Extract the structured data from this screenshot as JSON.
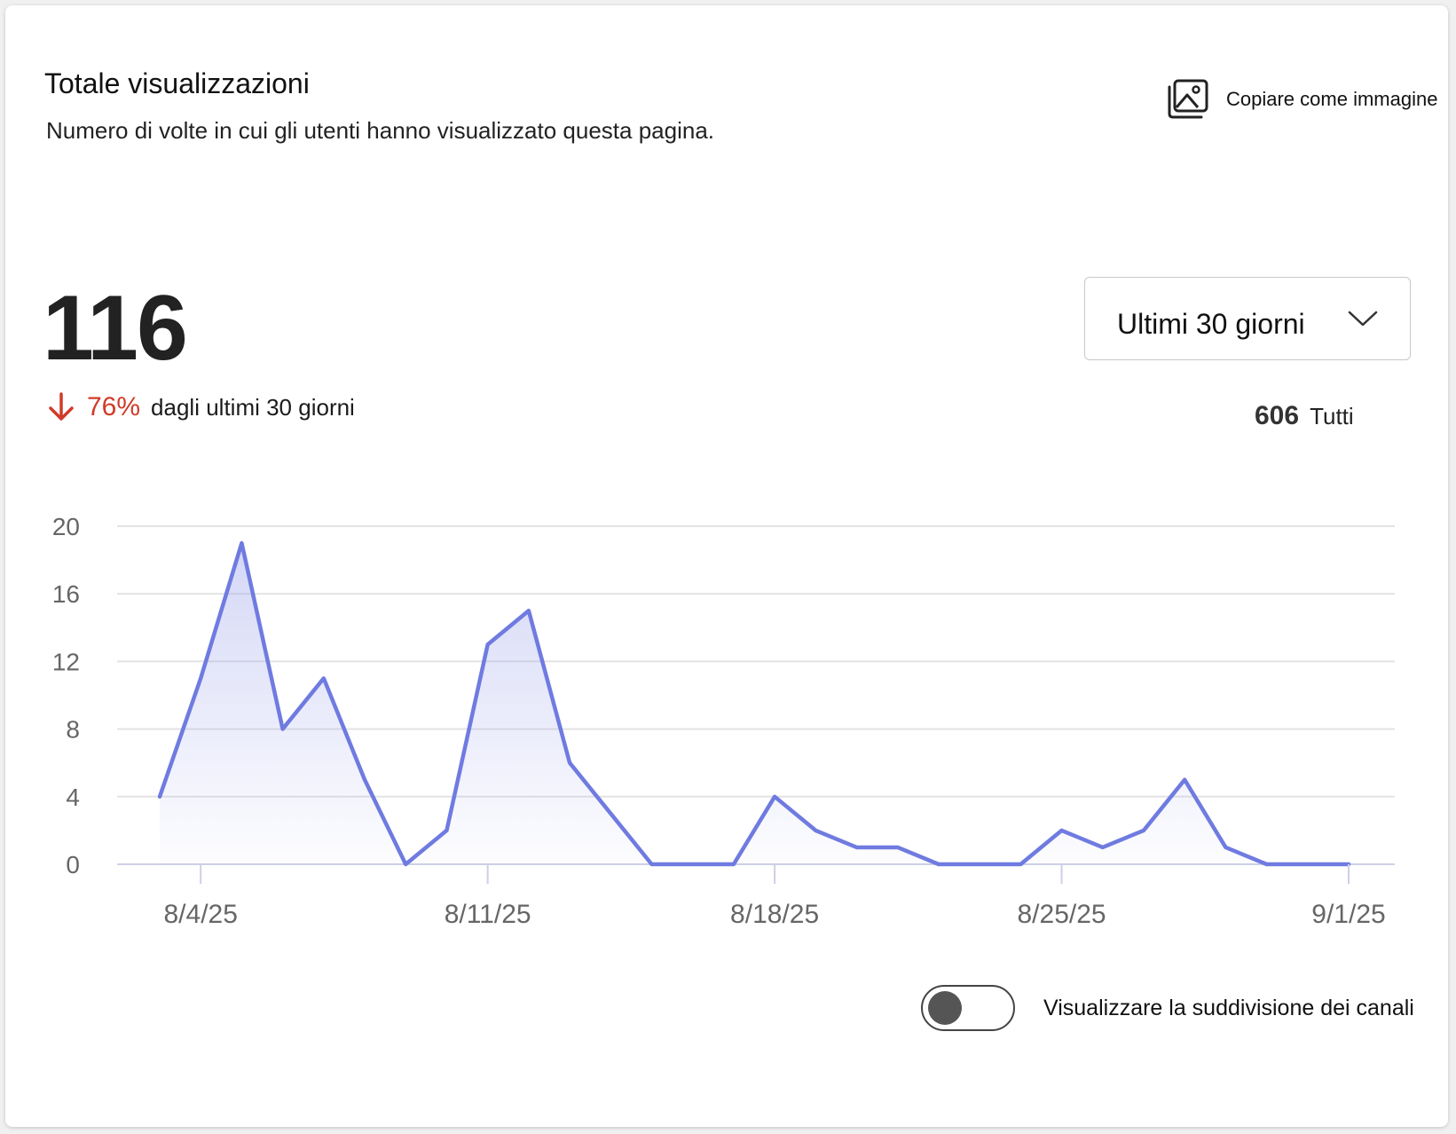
{
  "header": {
    "title": "Totale visualizzazioni",
    "subtitle": "Numero di volte in cui gli utenti hanno visualizzato questa pagina.",
    "copy_label": "Copiare come immagine"
  },
  "summary": {
    "value": "116",
    "delta_pct": "76%",
    "delta_direction": "down",
    "delta_text": "dagli ultimi 30 giorni",
    "total_value": "606",
    "total_label": "Tutti"
  },
  "range_select": {
    "selected": "Ultimi 30 giorni"
  },
  "toggle": {
    "label": "Visualizzare la suddivisione dei canali",
    "on": false
  },
  "colors": {
    "line": "#6f7be0",
    "delta": "#d13a29",
    "grid": "#e3e3e3"
  },
  "chart_data": {
    "type": "area",
    "x": [
      "8/3/25",
      "8/4/25",
      "8/5/25",
      "8/6/25",
      "8/7/25",
      "8/8/25",
      "8/9/25",
      "8/10/25",
      "8/11/25",
      "8/12/25",
      "8/13/25",
      "8/14/25",
      "8/15/25",
      "8/16/25",
      "8/17/25",
      "8/18/25",
      "8/19/25",
      "8/20/25",
      "8/21/25",
      "8/22/25",
      "8/23/25",
      "8/24/25",
      "8/25/25",
      "8/26/25",
      "8/27/25",
      "8/28/25",
      "8/29/25",
      "8/30/25",
      "8/31/25",
      "9/1/25"
    ],
    "series": [
      {
        "values": [
          4,
          11,
          19,
          8,
          11,
          5,
          0,
          2,
          13,
          15,
          6,
          3,
          0,
          0,
          0,
          4,
          2,
          1,
          1,
          0,
          0,
          0,
          2,
          1,
          2,
          5,
          1,
          0,
          0,
          0
        ]
      }
    ],
    "x_ticks": [
      "8/4/25",
      "8/11/25",
      "8/18/25",
      "8/25/25",
      "9/1/25"
    ],
    "y_ticks": [
      0,
      4,
      8,
      12,
      16,
      20
    ],
    "ylim": [
      0,
      20
    ],
    "grid": true,
    "legend": "none"
  }
}
